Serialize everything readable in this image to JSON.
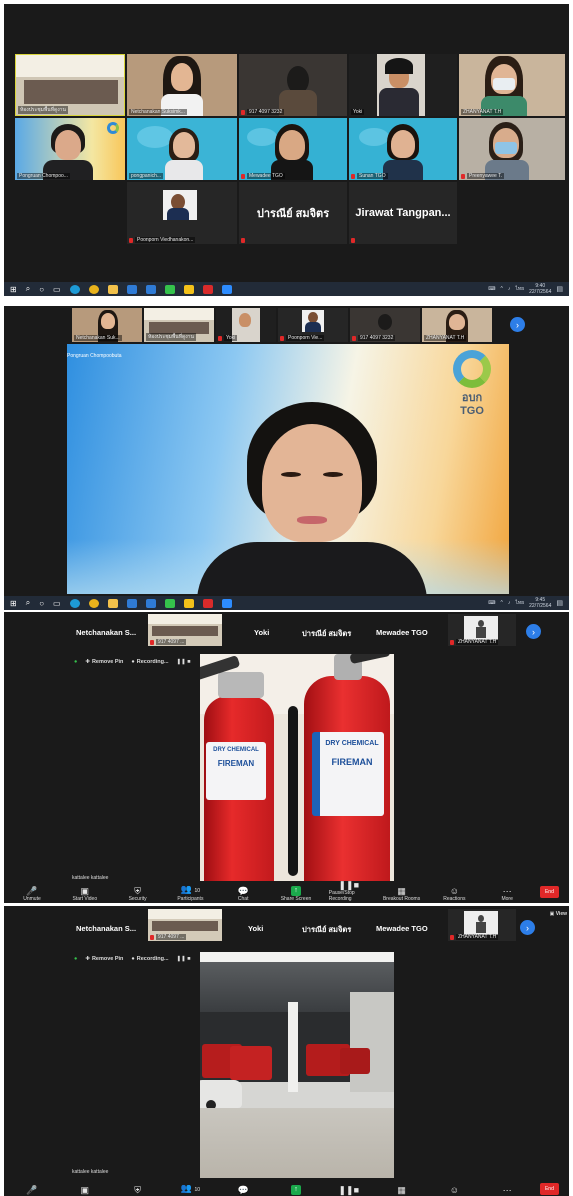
{
  "taskbar": {
    "time1": "9:40",
    "date1": "22/7/2564",
    "time2": "9:45",
    "date2": "22/7/2564",
    "lang": "ไทย"
  },
  "gallery": {
    "row1": [
      "ห้องประชุมพื้นที่ดูงาน",
      "Netchanakan Suksimk...",
      "917 4097 3232",
      "Yoki",
      "ZHANYANAT T.H"
    ],
    "row2": [
      "Pongruan Chompoo...",
      "pongpanich...",
      "Mewadee TGO",
      "Sunan TGO",
      "Preenyawee T."
    ],
    "row3": [
      "Poonporn Viedhanakon...",
      "ปารณีย์ สมจิตร",
      "Jirawat Tangpan..."
    ]
  },
  "speaker": {
    "strip": [
      "Netchanakan Suk...",
      "ห้องประชุมพื้นที่ดูงาน",
      "Yoki",
      "Poonporn Vie...",
      "917 4097 3232",
      "ZHANYANAT T.H"
    ],
    "name": "Pongruan Chompoobuta",
    "logo_top": "อบก",
    "logo_bottom": "TGO"
  },
  "share1": {
    "strip": [
      "Netchanakan S...",
      "917 4097 ...",
      "Yoki",
      "ปารณีย์ สมจิตร",
      "Mewadee TGO",
      "ZHANYANAT T.H"
    ],
    "remove": "Remove Pin",
    "recording": "Recording...",
    "presenter": "kattalee kattalee"
  },
  "share2": {
    "strip": [
      "Netchanakan S...",
      "917 4097 ...",
      "Yoki",
      "ปารณีย์ สมจิตร",
      "Mewadee TGO",
      "ZHANYANAT T.H"
    ],
    "remove": "Remove Pin",
    "recording": "Recording...",
    "presenter": "kattalee kattalee",
    "view": "View"
  },
  "extinguisher": {
    "brand1": "DRY CHEMICAL",
    "brand2": "FIREMAN"
  },
  "toolbar": {
    "unmute": "Unmute",
    "video": "Start Video",
    "security": "Security",
    "participants": "Participants",
    "participants_count": "10",
    "chat": "Chat",
    "share": "Share Screen",
    "record": "Pause/Stop Recording",
    "breakout": "Breakout Rooms",
    "reactions": "Reactions",
    "more": "More",
    "end": "End"
  }
}
